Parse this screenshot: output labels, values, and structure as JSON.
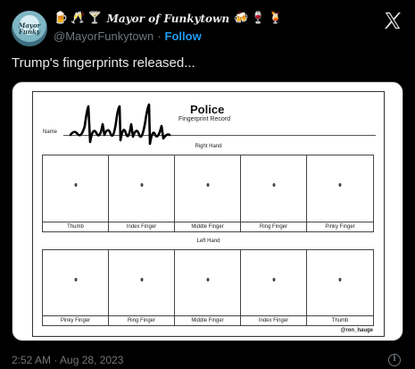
{
  "author": {
    "display_name": "Mayor of Funkytown",
    "handle": "@MayorFunkytown",
    "follow_label": "Follow",
    "avatar_text": "Mayor Funky",
    "leading_emojis": [
      "🍺",
      "🥂",
      "🍸"
    ],
    "trailing_emojis": [
      "🍻",
      "🍷",
      "🍹"
    ]
  },
  "tweet": {
    "text": "Trump's fingerprints released...",
    "timestamp": "2:52 AM · Aug 28, 2023"
  },
  "image": {
    "title": "Police",
    "subtitle": "Fingerprint Record",
    "name_label": "Name",
    "right_hand": {
      "label": "Right Hand",
      "fingers": [
        "Thumb",
        "Index Finger",
        "Middle Finger",
        "Ring Finger",
        "Pinky Finger"
      ]
    },
    "left_hand": {
      "label": "Left Hand",
      "fingers": [
        "Pinky Finger",
        "Ring Finger",
        "Middle Finger",
        "Index Finger",
        "Thumb"
      ]
    },
    "credit": "@ron_hauge"
  },
  "icons": {
    "brand": "x-logo-icon",
    "info": "info-icon"
  }
}
